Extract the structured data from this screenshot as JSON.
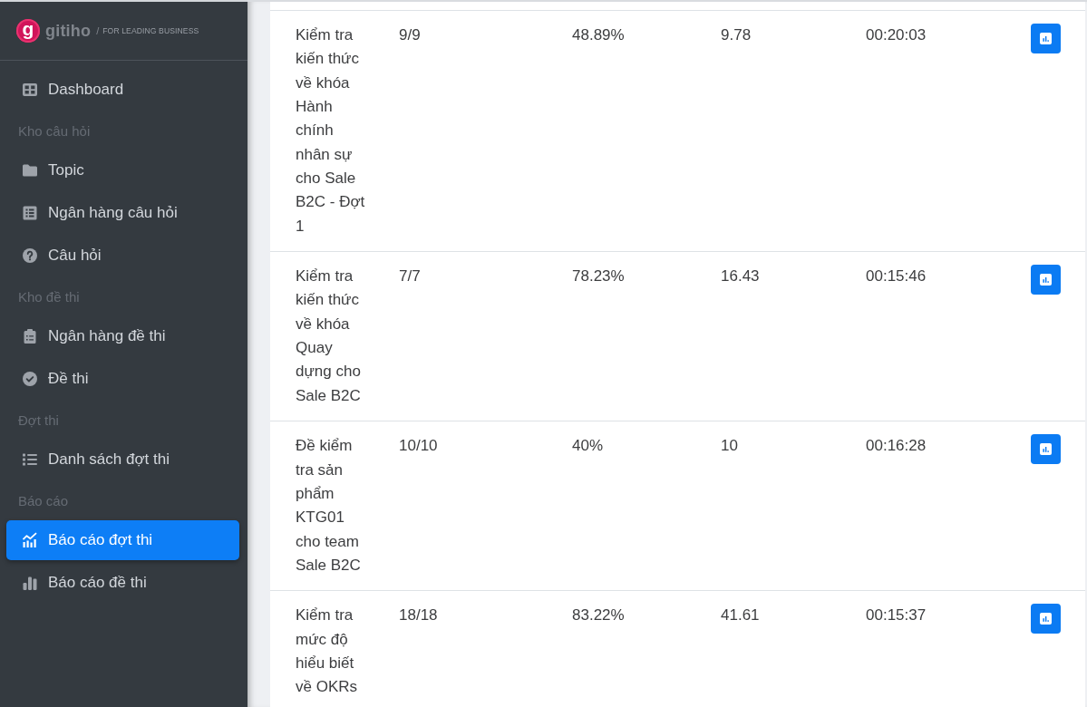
{
  "sidebar": {
    "logo": {
      "mark": "g",
      "name": "gitiho",
      "separator": "/",
      "tagline": "FOR LEADING BUSINESS"
    },
    "sections": [
      {
        "items": [
          {
            "label": "Dashboard",
            "selected": false
          }
        ]
      },
      {
        "heading": "Kho câu hỏi",
        "items": [
          {
            "label": "Topic",
            "selected": false
          },
          {
            "label": "Ngân hàng câu hỏi",
            "selected": false
          },
          {
            "label": "Câu hỏi",
            "selected": false
          }
        ]
      },
      {
        "heading": "Kho đề thi",
        "items": [
          {
            "label": "Ngân hàng đề thi",
            "selected": false
          },
          {
            "label": "Đề thi",
            "selected": false
          }
        ]
      },
      {
        "heading": "Đợt thi",
        "items": [
          {
            "label": "Danh sách đợt thi",
            "selected": false
          }
        ]
      },
      {
        "heading": "Báo cáo",
        "items": [
          {
            "label": "Báo cáo đợt thi",
            "selected": true
          },
          {
            "label": "Báo cáo đề thi",
            "selected": false
          }
        ]
      }
    ]
  },
  "table": {
    "rows": [
      {
        "cells": [
          "Kiểm tra kiến thức về khóa Hành chính nhân sự cho Sale B2C - Đợt 1",
          "9/9",
          "48.89%",
          "9.78",
          "00:20:03"
        ]
      },
      {
        "cells": [
          "Kiểm tra kiến thức về khóa Quay dựng cho Sale B2C",
          "7/7",
          "78.23%",
          "16.43",
          "00:15:46"
        ]
      },
      {
        "cells": [
          "Đề kiểm tra sản phẩm KTG01 cho team Sale B2C",
          "10/10",
          "40%",
          "10",
          "00:16:28"
        ]
      },
      {
        "cells": [
          "Kiểm tra mức độ hiểu biết về OKRs",
          "18/18",
          "83.22%",
          "41.61",
          "00:15:37"
        ]
      }
    ]
  }
}
